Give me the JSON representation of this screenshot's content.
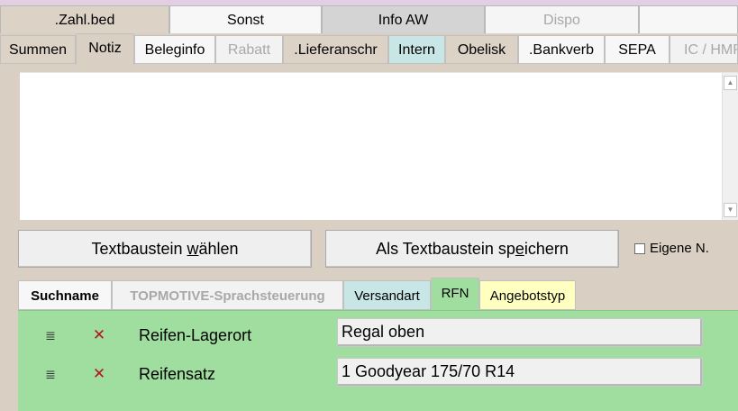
{
  "top_tabs": [
    ".Zahl.bed",
    "Sonst",
    "Info AW",
    "Dispo",
    ""
  ],
  "second_tabs": [
    "Summen",
    "Notiz",
    "Beleginfo",
    "Rabatt",
    ".Lieferanschr",
    "Intern",
    "Obelisk",
    ".Bankverb",
    "SEPA",
    "IC / HMR"
  ],
  "note": {
    "text": ""
  },
  "buttons": {
    "choose_prefix": "Textbaustein ",
    "choose_access": "w",
    "choose_suffix": "ählen",
    "save_prefix": "Als Textbaustein sp",
    "save_access": "e",
    "save_suffix": "ichern"
  },
  "checkbox": {
    "label": "Eigene N.",
    "checked": false
  },
  "lower_tabs": [
    "Suchname",
    "TOPMOTIVE-Sprachsteuerung",
    "Versandart",
    "RFN",
    "Angebotstyp"
  ],
  "rows": [
    {
      "label": "Reifen-Lagerort",
      "value": "Regal oben"
    },
    {
      "label": "Reifensatz",
      "value": "1 Goodyear 175/70 R14"
    }
  ],
  "icons": {
    "list": "list-icon",
    "remove": "remove-x-icon",
    "scroll_up": "scroll-up-arrow-icon",
    "scroll_down": "scroll-down-arrow-icon"
  },
  "colors": {
    "window_bg": "#d9cfc3",
    "panel_green": "#a0dea0",
    "tab_cyan": "#c8e6e6",
    "tab_yellow": "#ffffc0",
    "delete_red": "#b0181c"
  }
}
